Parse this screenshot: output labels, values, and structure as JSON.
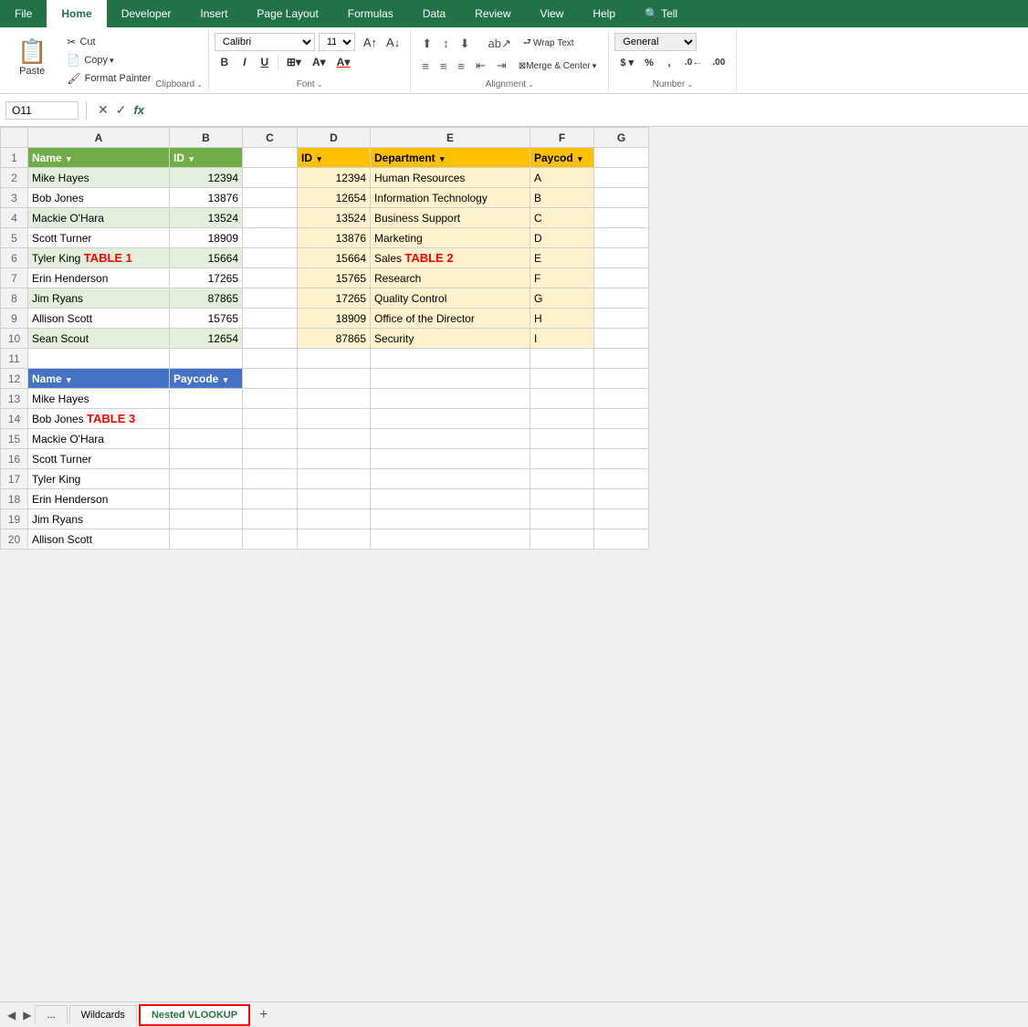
{
  "ribbon": {
    "tabs": [
      "File",
      "Home",
      "Developer",
      "Insert",
      "Page Layout",
      "Formulas",
      "Data",
      "Review",
      "View",
      "Help",
      "Tell"
    ],
    "active_tab": "Home",
    "clipboard": {
      "paste_label": "Paste",
      "cut_label": "Cut",
      "copy_label": "Copy",
      "format_painter_label": "Format Painter",
      "group_label": "Clipboard"
    },
    "font": {
      "font_name": "Calibri",
      "font_size": "11",
      "group_label": "Font"
    },
    "alignment": {
      "wrap_text": "Wrap Text",
      "merge_center": "Merge & Center",
      "group_label": "Alignment"
    },
    "number": {
      "format": "General",
      "group_label": "Number"
    }
  },
  "formula_bar": {
    "cell_ref": "O11",
    "formula": ""
  },
  "spreadsheet": {
    "columns": [
      "A",
      "B",
      "C",
      "D",
      "E",
      "F"
    ],
    "table1": {
      "label": "TABLE 1",
      "headers": [
        "Name",
        "ID"
      ],
      "rows": [
        [
          "Mike Hayes",
          "12394"
        ],
        [
          "Bob Jones",
          "13876"
        ],
        [
          "Mackie O'Hara",
          "13524"
        ],
        [
          "Scott Turner",
          "18909"
        ],
        [
          "Tyler King",
          "15664"
        ],
        [
          "Erin Henderson",
          "17265"
        ],
        [
          "Jim Ryans",
          "87865"
        ],
        [
          "Allison Scott",
          "15765"
        ],
        [
          "Sean Scout",
          "12654"
        ]
      ]
    },
    "table2": {
      "label": "TABLE 2",
      "headers": [
        "ID",
        "Department",
        "Paycod"
      ],
      "rows": [
        [
          "12394",
          "Human Resources",
          "A"
        ],
        [
          "12654",
          "Information Technology",
          "B"
        ],
        [
          "13524",
          "Business Support",
          "C"
        ],
        [
          "13876",
          "Marketing",
          "D"
        ],
        [
          "15664",
          "Sales",
          "E"
        ],
        [
          "15765",
          "Research",
          "F"
        ],
        [
          "17265",
          "Quality Control",
          "G"
        ],
        [
          "18909",
          "Office of the Director",
          "H"
        ],
        [
          "87865",
          "Security",
          "I"
        ]
      ]
    },
    "table3": {
      "label": "TABLE 3",
      "headers": [
        "Name",
        "Paycode"
      ],
      "rows": [
        [
          "Mike Hayes",
          ""
        ],
        [
          "Bob Jones",
          ""
        ],
        [
          "Mackie O'Hara",
          ""
        ],
        [
          "Scott Turner",
          ""
        ],
        [
          "Tyler King",
          ""
        ],
        [
          "Erin Henderson",
          ""
        ],
        [
          "Jim Ryans",
          ""
        ],
        [
          "Allison Scott",
          ""
        ]
      ]
    }
  },
  "tabs": {
    "sheets": [
      "...",
      "Wildcards",
      "Nested VLOOKUP"
    ],
    "active": "Nested VLOOKUP",
    "add_label": "+"
  }
}
